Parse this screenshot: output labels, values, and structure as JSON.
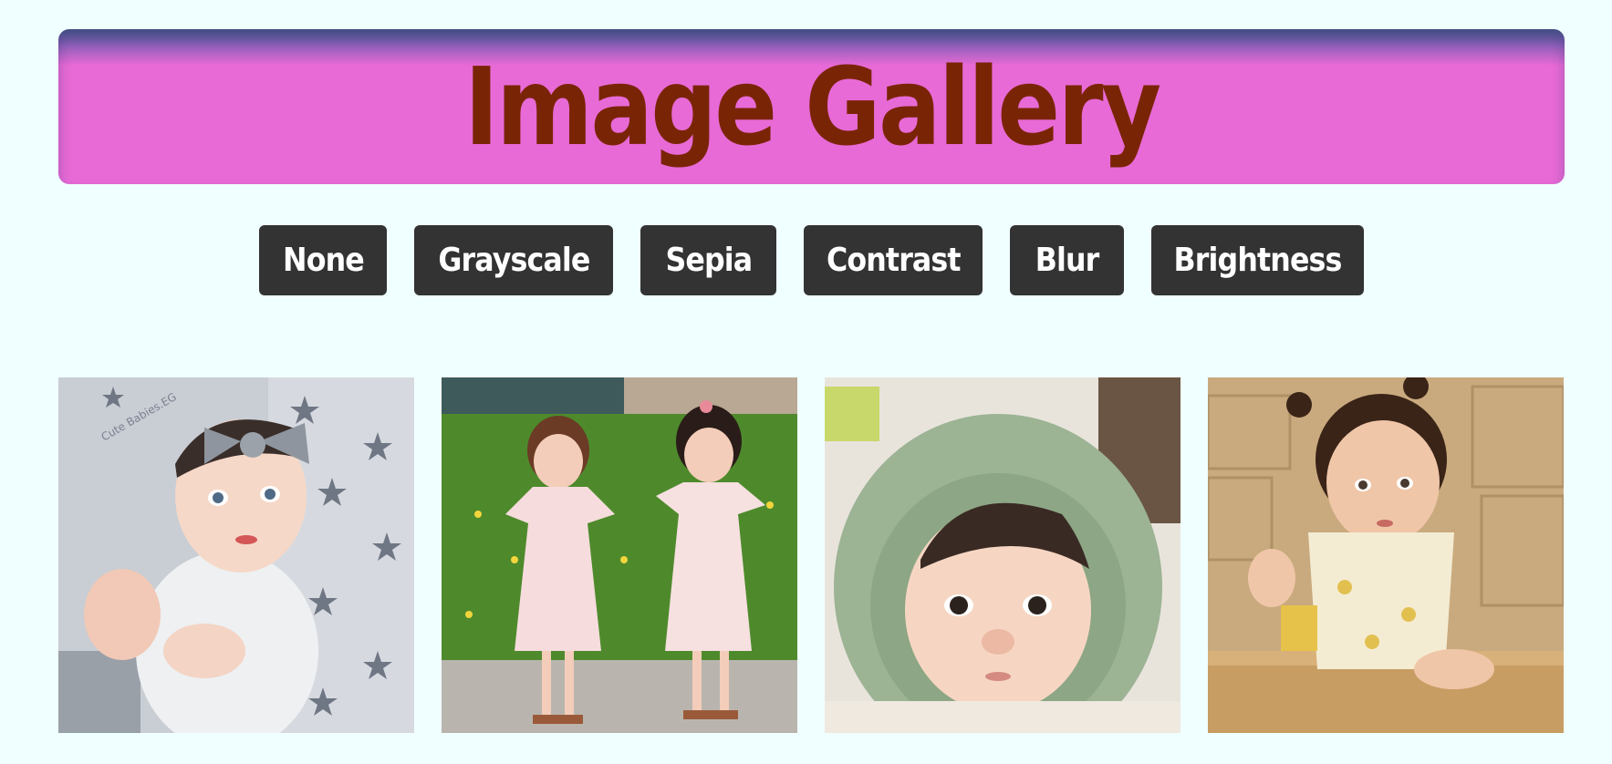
{
  "header": {
    "title": "Image Gallery"
  },
  "filters": [
    {
      "label": "None"
    },
    {
      "label": "Grayscale"
    },
    {
      "label": "Sepia"
    },
    {
      "label": "Contrast"
    },
    {
      "label": "Blur"
    },
    {
      "label": "Brightness"
    }
  ],
  "gallery": {
    "images": [
      {
        "watermark": "Cute Babies.EG"
      },
      {},
      {},
      {}
    ]
  },
  "colors": {
    "background": "#f0ffff",
    "header": "#e86ad6",
    "title": "#7a2406",
    "button": "#333333",
    "button_text": "#ffffff"
  }
}
